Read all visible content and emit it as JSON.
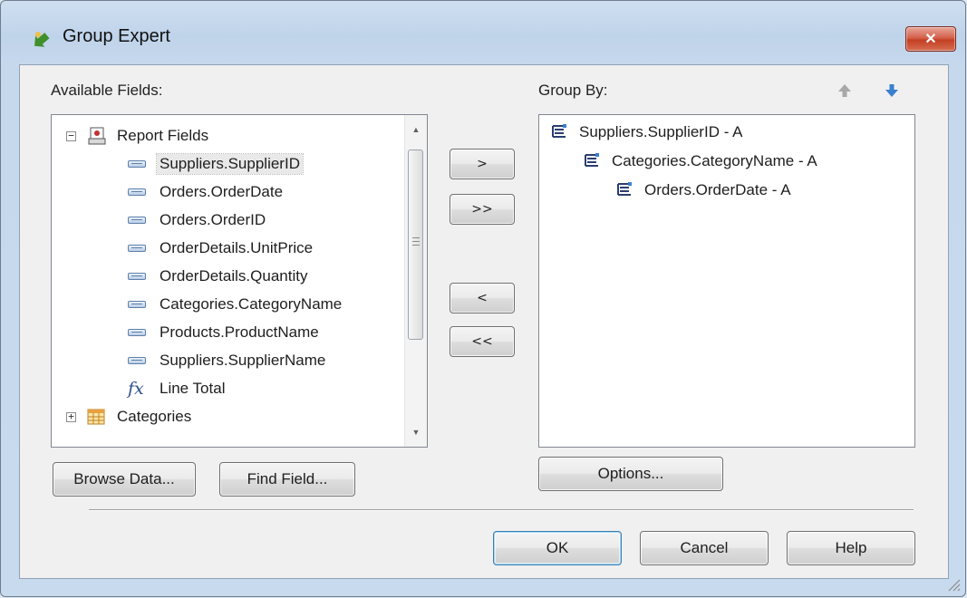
{
  "window": {
    "title": "Group Expert",
    "close_symbol": "✕"
  },
  "available": {
    "label": "Available Fields:",
    "items": [
      {
        "label": "Report Fields",
        "kind": "root",
        "expander": "−",
        "icon": "report-icon"
      },
      {
        "label": "Suppliers.SupplierID",
        "kind": "field",
        "icon": "field-icon",
        "selected": true
      },
      {
        "label": "Orders.OrderDate",
        "kind": "field",
        "icon": "field-icon"
      },
      {
        "label": "Orders.OrderID",
        "kind": "field",
        "icon": "field-icon"
      },
      {
        "label": "OrderDetails.UnitPrice",
        "kind": "field",
        "icon": "field-icon"
      },
      {
        "label": "OrderDetails.Quantity",
        "kind": "field",
        "icon": "field-icon"
      },
      {
        "label": "Categories.CategoryName",
        "kind": "field",
        "icon": "field-icon"
      },
      {
        "label": "Products.ProductName",
        "kind": "field",
        "icon": "field-icon"
      },
      {
        "label": "Suppliers.SupplierName",
        "kind": "field",
        "icon": "field-icon"
      },
      {
        "label": "Line Total",
        "kind": "formula",
        "icon": "fx-icon",
        "icon_text": "fx"
      },
      {
        "label": "Categories",
        "kind": "table",
        "expander": "+",
        "icon": "table-icon"
      }
    ]
  },
  "transfer": {
    "add": ">",
    "add_all": ">>",
    "remove": "<",
    "remove_all": "<<"
  },
  "group_by": {
    "label": "Group By:",
    "items": [
      {
        "label": "Suppliers.SupplierID - A",
        "level": 0
      },
      {
        "label": "Categories.CategoryName - A",
        "level": 1
      },
      {
        "label": "Orders.OrderDate - A",
        "level": 2
      }
    ]
  },
  "buttons": {
    "browse": "Browse Data...",
    "find": "Find Field...",
    "options": "Options...",
    "ok": "OK",
    "cancel": "Cancel",
    "help": "Help"
  },
  "colors": {
    "accent_blue": "#3c7fb1",
    "close_red": "#c43f22",
    "move_up_gray": "#a8a8a8",
    "move_down_blue": "#3a7fd0"
  }
}
